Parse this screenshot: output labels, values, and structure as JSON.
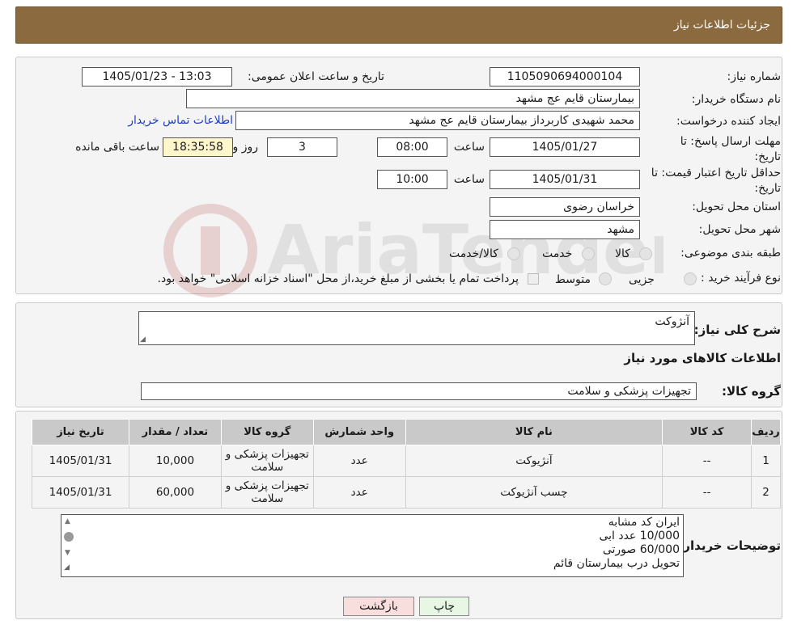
{
  "header": {
    "title": "جزئیات اطلاعات نیاز"
  },
  "form": {
    "need_number_label": "شماره نیاز:",
    "need_number": "1105090694000104",
    "announce_label": "تاریخ و ساعت اعلان عمومی:",
    "announce_value": "1405/01/23 - 13:03",
    "buyer_org_label": "نام دستگاه خریدار:",
    "buyer_org": "بیمارستان قایم  عج  مشهد",
    "creator_label": "ایجاد کننده درخواست:",
    "creator": "محمد شهیدی کاربرداز بیمارستان قایم  عج  مشهد",
    "contact_link": "اطلاعات تماس خریدار",
    "deadline_label": "مهلت ارسال پاسخ: تا تاریخ:",
    "deadline_date": "1405/01/27",
    "time_label": "ساعت",
    "deadline_time": "08:00",
    "days": "3",
    "days_label": "روز و",
    "remaining": "18:35:58",
    "remaining_label": "ساعت باقی مانده",
    "validity_label": "حداقل تاریخ اعتبار قیمت: تا تاریخ:",
    "validity_date": "1405/01/31",
    "validity_time": "10:00",
    "province_label": "استان محل تحویل:",
    "province": "خراسان رضوی",
    "city_label": "شهر محل تحویل:",
    "city": "مشهد",
    "category_label": "طبقه بندی موضوعی:",
    "category_options": [
      "کالا",
      "خدمت",
      "کالا/خدمت"
    ],
    "process_label": "نوع فرآیند خرید :",
    "process_options": [
      "جزیی",
      "متوسط"
    ],
    "process_note": "پرداخت تمام یا بخشی از مبلغ خرید،از محل \"اسناد خزانه اسلامی\" خواهد بود."
  },
  "watermark": {
    "text": "AriaTender.neT"
  },
  "summary": {
    "title_label": "شرح کلی نیاز:",
    "title_value": "آنژوکت",
    "goods_info_label": "اطلاعات کالاهای مورد نیاز",
    "group_label": "گروه کالا:",
    "group_value": "تجهیزات پزشکی و سلامت"
  },
  "table": {
    "headers": [
      "ردیف",
      "کد کالا",
      "نام کالا",
      "واحد شمارش",
      "گروه کالا",
      "تعداد / مقدار",
      "تاریخ نیاز"
    ],
    "rows": [
      [
        "1",
        "--",
        "آنژیوکت",
        "عدد",
        "تجهیزات پزشکی و سلامت",
        "10,000",
        "1405/01/31"
      ],
      [
        "2",
        "--",
        "چسب آنژیوکت",
        "عدد",
        "تجهیزات پزشکی و سلامت",
        "60,000",
        "1405/01/31"
      ]
    ]
  },
  "notes": {
    "label": "توضیحات خریدار:",
    "lines": [
      "ایران کد مشابه",
      "10/000 عدد  ابی",
      "60/000 صورتی",
      "تحویل  درب  بیمارستان قائم"
    ]
  },
  "buttons": {
    "print": "چاپ",
    "back": "بازگشت"
  }
}
